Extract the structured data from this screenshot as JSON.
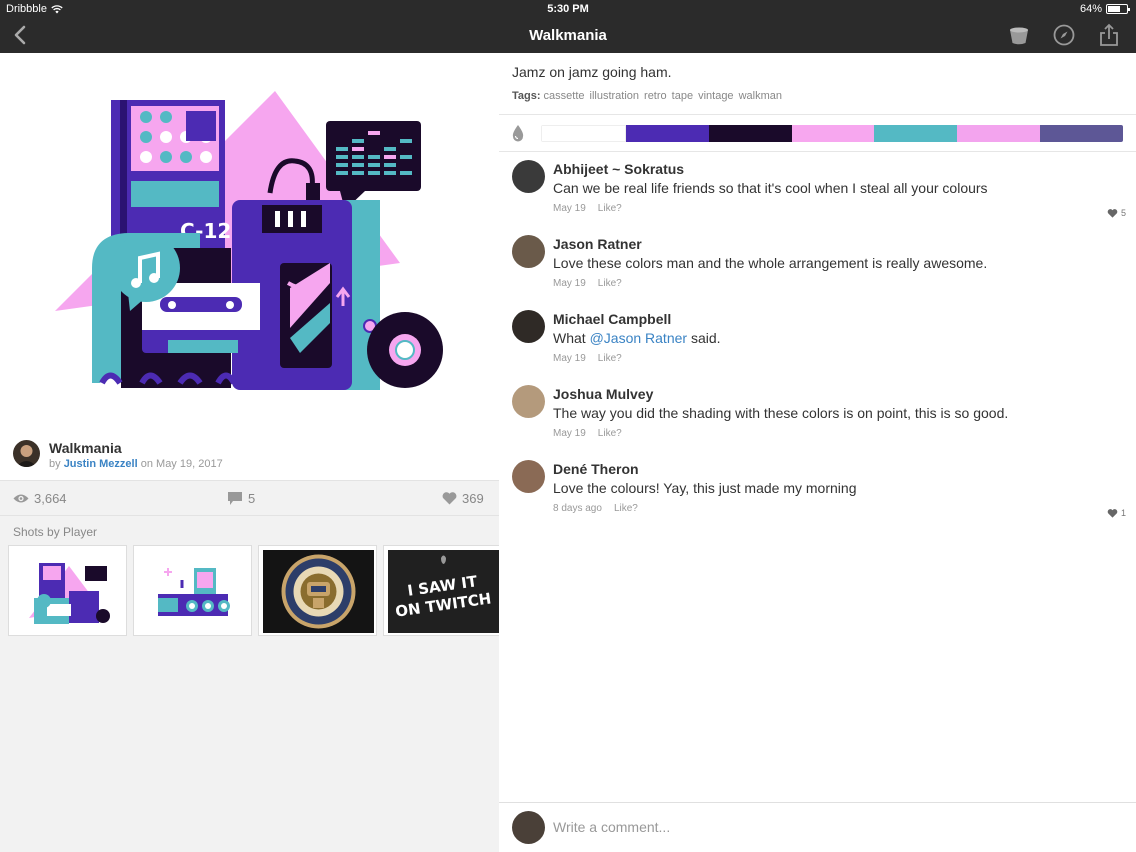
{
  "status_bar": {
    "carrier": "Dribbble",
    "time": "5:30 PM",
    "battery": "64%",
    "battery_level": 0.64
  },
  "nav": {
    "title": "Walkmania",
    "back_icon": "chevron-left-icon",
    "icons": [
      "bucket-icon",
      "compass-icon",
      "share-icon"
    ]
  },
  "shot": {
    "title": "Walkmania",
    "by_label": "by",
    "author": "Justin Mezzell",
    "on_label": "on",
    "date": "May 19, 2017",
    "views": "3,664",
    "comments": "5",
    "likes": "369"
  },
  "shots_by_player": {
    "label": "Shots by Player",
    "thumbs": [
      {
        "name": "walkmania-thumb"
      },
      {
        "name": "retro-devices-thumb"
      },
      {
        "name": "badge-thumb"
      },
      {
        "name": "twitch-thumb",
        "text1": "I SAW IT",
        "text2": "ON TWITCH"
      }
    ]
  },
  "details": {
    "description": "Jamz on jamz going ham.",
    "tags_label": "Tags:",
    "tags": [
      "cassette",
      "illustration",
      "retro",
      "tape",
      "vintage",
      "walkman"
    ]
  },
  "palette": {
    "icon": "droplet-icon",
    "colors": [
      "#ffffff",
      "#4c2bb3",
      "#1a0a2a",
      "#f7a7ef",
      "#54b9c4",
      "#f3a4ee",
      "#5d5796"
    ]
  },
  "comments": [
    {
      "name": "Abhijeet ~ Sokratus",
      "text": "Can we be real life friends so that it's cool when I steal all your colours",
      "date": "May 19",
      "like_label": "Like?",
      "likes": "5",
      "avatar_color": "#3a3a3a"
    },
    {
      "name": "Jason Ratner",
      "text": "Love these colors man and the whole arrangement is really awesome.",
      "date": "May 19",
      "like_label": "Like?",
      "likes": "",
      "avatar_color": "#6a5a4a"
    },
    {
      "name": "Michael Campbell",
      "text_before": "What ",
      "mention": "@Jason Ratner",
      "text_after": " said.",
      "date": "May 19",
      "like_label": "Like?",
      "likes": "",
      "avatar_color": "#2f2a26"
    },
    {
      "name": "Joshua Mulvey",
      "text": "The way you did the shading with these colors is on point, this is so good.",
      "date": "May 19",
      "like_label": "Like?",
      "likes": "",
      "avatar_color": "#b49a7c"
    },
    {
      "name": "Dené Theron",
      "text": "Love the colours! Yay, this just made my morning",
      "date": "8 days ago",
      "like_label": "Like?",
      "likes": "1",
      "avatar_color": "#8a6a55"
    }
  ],
  "compose": {
    "placeholder": "Write a comment..."
  }
}
